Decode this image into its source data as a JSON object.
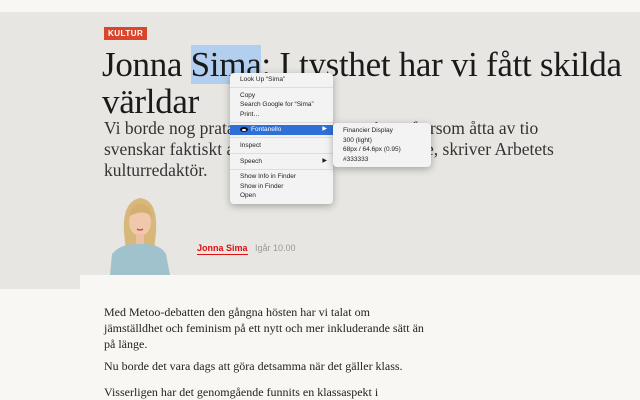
{
  "article": {
    "tag": "KULTUR",
    "headline_pre": "Jonna ",
    "headline_selected": "Sima",
    "headline_post": ": I tysthet har vi fått skilda världar",
    "subtitle_fragments": [
      "Vi borde nog prata m",
      "inst eftersom åtta av tio",
      "svenskar faktiskt ans",
      "e, skriver Arbetets",
      "kulturredaktör."
    ],
    "author": "Jonna Sima",
    "time": "Igår 10.00",
    "paragraphs": [
      "Med Metoo-debatten den gångna hösten har vi talat om jämställdhet och feminism på ett nytt och mer inkluderande sätt än på länge.",
      "Nu borde det vara dags att göra detsamma när det gäller klass.",
      "Visserligen har det genomgående funnits en klassaspekt i"
    ]
  },
  "context_menu": {
    "items": [
      "Look Up “Sima”",
      "Copy",
      "Search Google for “Sima”",
      "Print…",
      "Fontanello",
      "Inspect",
      "Speech",
      "Show Info in Finder",
      "Show in Finder",
      "Open"
    ],
    "highlighted": "Fontanello",
    "highlight_color": "#2f6fd8"
  },
  "fontanello": {
    "family": "Financier Display",
    "weight": "300 (light)",
    "size": "68px / 64.6px (0.95)",
    "color": "#333333"
  }
}
